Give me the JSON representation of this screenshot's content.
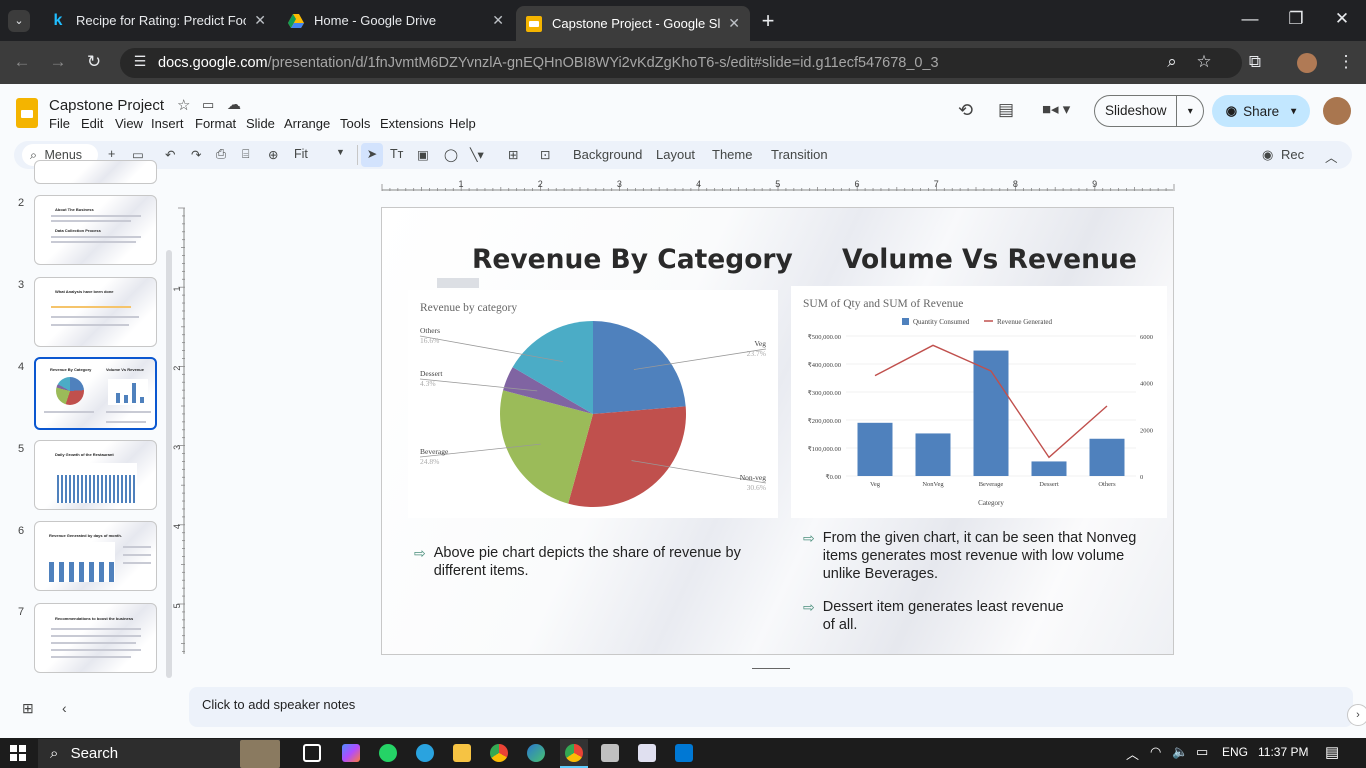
{
  "browser": {
    "tabs": [
      {
        "title": "Recipe for Rating: Predict Food",
        "favicon": "kaggle-k-icon"
      },
      {
        "title": "Home - Google Drive",
        "favicon": "google-drive-icon"
      },
      {
        "title": "Capstone Project - Google Slides",
        "favicon": "google-slides-icon"
      }
    ],
    "url_host": "docs.google.com",
    "url_path": "/presentation/d/1fnJvmtM6DZYvnzlA-gnEQHnOBI8WYi2vKdZgKhoT6-s/edit#slide=id.g11ecf547678_0_3"
  },
  "doc": {
    "title": "Capstone Project",
    "menus": [
      "File",
      "Edit",
      "View",
      "Insert",
      "Format",
      "Slide",
      "Arrange",
      "Tools",
      "Extensions",
      "Help"
    ],
    "slideshow_label": "Slideshow",
    "share_label": "Share"
  },
  "toolbar": {
    "search_label": "Menus",
    "zoom": "Fit",
    "background": "Background",
    "layout": "Layout",
    "theme": "Theme",
    "transition": "Transition",
    "rec": "Rec"
  },
  "ruler": {
    "h": [
      "1",
      "2",
      "3",
      "4",
      "5",
      "6",
      "7",
      "8",
      "9"
    ],
    "v": [
      "1",
      "2",
      "3",
      "4",
      "5"
    ]
  },
  "filmstrip": [
    {
      "num": "2",
      "heading": "About The Business",
      "heading2": "Data Collection Process"
    },
    {
      "num": "3",
      "heading": "What Analysis have been done"
    },
    {
      "num": "4",
      "heading": "Revenue By Category",
      "heading2": "Volume Vs Revenue"
    },
    {
      "num": "5",
      "heading": "Daily Growth of the Restaurant"
    },
    {
      "num": "6",
      "heading": "Revenue Generated by days of month."
    },
    {
      "num": "7",
      "heading": "Recommendations to boost the business"
    }
  ],
  "slide": {
    "left_title": "Revenue By Category",
    "right_title": "Volume Vs Revenue",
    "left_bullets": [
      "Above pie chart depicts the share of revenue by different items."
    ],
    "right_bullets": [
      "From the given chart, it can be seen that Nonveg items generates most revenue with low volume unlike Beverages.",
      "Dessert item generates least revenue of all."
    ]
  },
  "chart_data": [
    {
      "type": "pie",
      "title": "Revenue by category",
      "categories": [
        "Veg",
        "Non-veg",
        "Beverage",
        "Dessert",
        "Others"
      ],
      "values": [
        23.7,
        30.6,
        24.8,
        4.3,
        16.6
      ],
      "labels": [
        "23.7%",
        "30.6%",
        "24.8%",
        "4.3%",
        "16.6%"
      ],
      "colors": [
        "#4f81bd",
        "#c0504d",
        "#9bbb59",
        "#8064a2",
        "#4bacc6"
      ]
    },
    {
      "type": "bar",
      "title": "SUM of Qty and SUM of Revenue",
      "categories": [
        "Veg",
        "NonVeg",
        "Beverage",
        "Dessert",
        "Others"
      ],
      "xlabel": "Category",
      "series": [
        {
          "name": "Quantity Consumed",
          "type": "bar",
          "axis": "left",
          "values": [
            190000,
            152000,
            448000,
            52000,
            133000
          ],
          "color": "#4f81bd"
        },
        {
          "name": "Revenue Generated",
          "type": "line",
          "axis": "right",
          "values": [
            4300,
            5600,
            4500,
            800,
            3000
          ],
          "color": "#c0504d"
        }
      ],
      "y_left_ticks": [
        "₹0.00",
        "₹100,000.00",
        "₹200,000.00",
        "₹300,000.00",
        "₹400,000.00",
        "₹500,000.00"
      ],
      "y_right_ticks": [
        "0",
        "2000",
        "4000",
        "6000"
      ],
      "ylim_left": [
        0,
        500000
      ],
      "ylim_right": [
        0,
        6000
      ],
      "legend": "top"
    }
  ],
  "notes": {
    "placeholder": "Click to add speaker notes"
  },
  "taskbar": {
    "search": "Search",
    "lang": "ENG",
    "time": "11:37 PM"
  }
}
